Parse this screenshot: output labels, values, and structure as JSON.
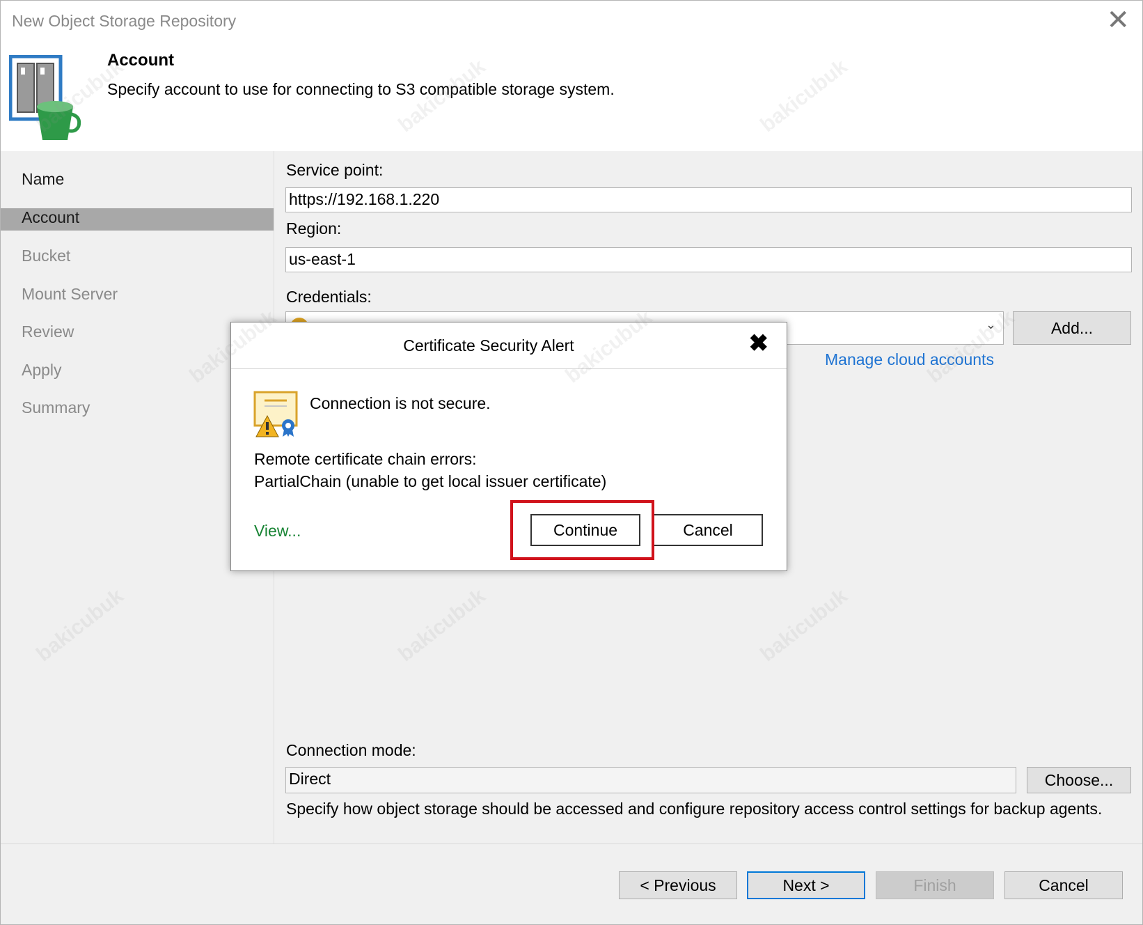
{
  "window": {
    "title": "New Object Storage Repository"
  },
  "header": {
    "title": "Account",
    "subtitle": "Specify account to use for connecting to S3 compatible storage system."
  },
  "sidebar": {
    "items": [
      {
        "label": "Name"
      },
      {
        "label": "Account"
      },
      {
        "label": "Bucket"
      },
      {
        "label": "Mount Server"
      },
      {
        "label": "Review"
      },
      {
        "label": "Apply"
      },
      {
        "label": "Summary"
      }
    ],
    "active_index": 1
  },
  "form": {
    "service_point_label": "Service point:",
    "service_point_value": "https://192.168.1.220",
    "region_label": "Region:",
    "region_value": "us-east-1",
    "credentials_label": "Credentials:",
    "add_button": "Add...",
    "manage_link": "Manage cloud accounts",
    "connection_mode_label": "Connection mode:",
    "connection_mode_value": "Direct",
    "choose_button": "Choose...",
    "connection_mode_hint": "Specify how object storage should be accessed and configure repository access control settings for backup agents."
  },
  "footer": {
    "previous": "< Previous",
    "next": "Next >",
    "finish": "Finish",
    "cancel": "Cancel"
  },
  "dialog": {
    "title": "Certificate Security Alert",
    "message": "Connection is not secure.",
    "error_heading": "Remote certificate chain errors:",
    "error_detail": "PartialChain (unable to get local issuer certificate)",
    "view_link": "View...",
    "continue_button": "Continue",
    "cancel_button": "Cancel"
  },
  "watermark": "bakicubuk",
  "colors": {
    "highlight": "#d0121b",
    "link": "#1e73d2",
    "view_link": "#188434",
    "active_nav": "#a8a8a8"
  }
}
